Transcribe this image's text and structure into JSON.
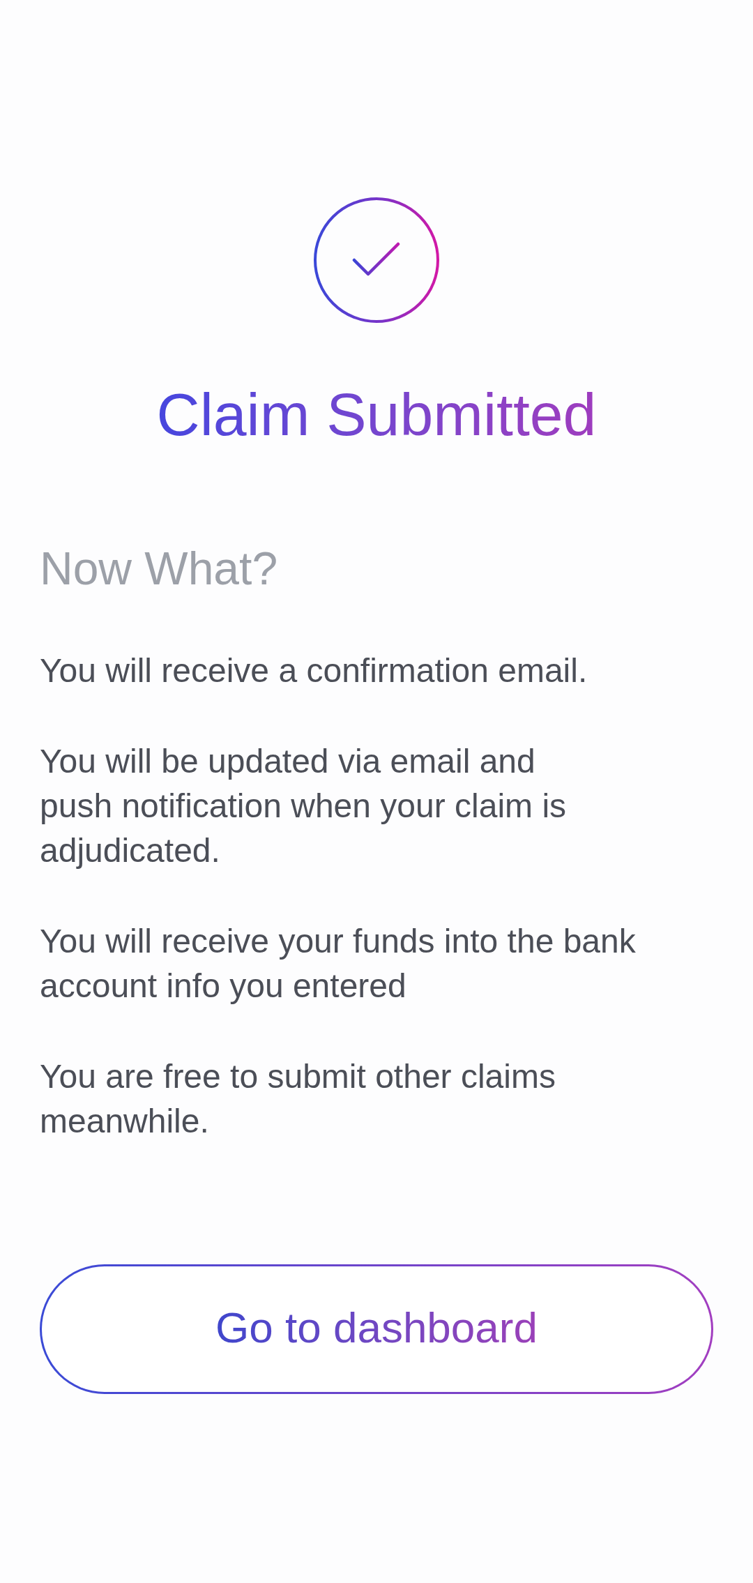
{
  "status": {
    "title": "Claim Submitted"
  },
  "next_steps": {
    "heading": "Now What?",
    "paragraphs": [
      {
        "lines": [
          "You will receive a confirmation email."
        ]
      },
      {
        "lines": [
          "You will be updated via email and",
          "push notification when your claim is",
          "adjudicated."
        ]
      },
      {
        "lines": [
          "You will receive your funds into the bank",
          "account info you entered"
        ]
      },
      {
        "lines": [
          "You are free to submit other claims",
          "meanwhile."
        ]
      }
    ]
  },
  "button": {
    "label": "Go to dashboard"
  }
}
